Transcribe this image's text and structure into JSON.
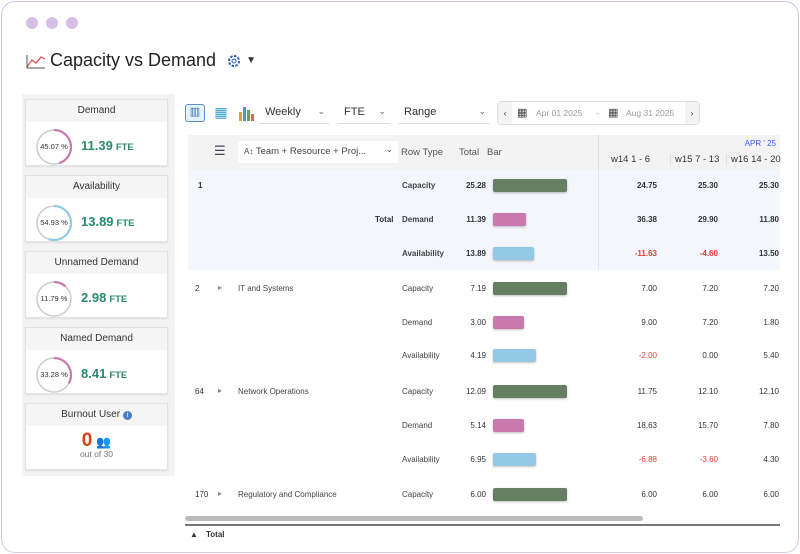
{
  "title": "Capacity vs Demand",
  "colors": {
    "capacity": "#667f63",
    "demand": "#c87aae",
    "availability": "#94c9e3",
    "fte": "#2b8a6e",
    "negative": "#e53935",
    "month": "#3d5afe"
  },
  "cards": [
    {
      "label": "Demand",
      "pct_text": "45.07 %",
      "pct": 45.07,
      "value": "11.39",
      "unit": "FTE",
      "color": "#c87aae"
    },
    {
      "label": "Availability",
      "pct_text": "54.93 %",
      "pct": 54.93,
      "value": "13.89",
      "unit": "FTE",
      "color": "#94c9e3"
    },
    {
      "label": "Unnamed Demand",
      "pct_text": "11.79 %",
      "pct": 11.79,
      "value": "2.98",
      "unit": "FTE",
      "color": "#c87aae"
    },
    {
      "label": "Named Demand",
      "pct_text": "33.28 %",
      "pct": 33.28,
      "value": "8.41",
      "unit": "FTE",
      "color": "#c87aae"
    }
  ],
  "burnout": {
    "label": "Burnout User",
    "count": "0",
    "sub": "out of 30"
  },
  "toolbar": {
    "period": "Weekly",
    "unit": "FTE",
    "range": "Range",
    "start": "Apr 01 2025",
    "sep": "-",
    "end": "Aug 31 2025"
  },
  "table": {
    "group_by": "Team + Resource + Proj...",
    "headers": {
      "row_type": "Row Type",
      "total": "Total",
      "bar": "Bar"
    },
    "month": "APR ' 25",
    "weeks": [
      "w14 1 - 6",
      "w15 7 - 13",
      "w16 14 - 20"
    ],
    "groups": [
      {
        "index": "1",
        "name": "Total",
        "bold": true,
        "rows": [
          {
            "type": "Capacity",
            "total": "25.28",
            "t": 25.28,
            "weeks": [
              "24.75",
              "25.30",
              "25.30"
            ]
          },
          {
            "type": "Demand",
            "total": "11.39",
            "t": 11.39,
            "weeks": [
              "36.38",
              "29.90",
              "11.80"
            ]
          },
          {
            "type": "Availability",
            "total": "13.89",
            "t": 13.89,
            "weeks": [
              "-11.63",
              "-4.60",
              "13.50"
            ]
          }
        ]
      },
      {
        "index": "2",
        "name": "IT and Systems",
        "rows": [
          {
            "type": "Capacity",
            "total": "7.19",
            "t": 7.19,
            "weeks": [
              "7.00",
              "7.20",
              "7.20"
            ]
          },
          {
            "type": "Demand",
            "total": "3.00",
            "t": 3.0,
            "weeks": [
              "9.00",
              "7.20",
              "1.80"
            ]
          },
          {
            "type": "Availability",
            "total": "4.19",
            "t": 4.19,
            "weeks": [
              "-2.00",
              "0.00",
              "5.40"
            ]
          }
        ]
      },
      {
        "index": "64",
        "name": "Network Operations",
        "rows": [
          {
            "type": "Capacity",
            "total": "12.09",
            "t": 12.09,
            "weeks": [
              "11.75",
              "12.10",
              "12.10"
            ]
          },
          {
            "type": "Demand",
            "total": "5.14",
            "t": 5.14,
            "weeks": [
              "18.63",
              "15.70",
              "7.80"
            ]
          },
          {
            "type": "Availability",
            "total": "6.95",
            "t": 6.95,
            "weeks": [
              "-6.88",
              "-3.60",
              "4.30"
            ]
          }
        ]
      },
      {
        "index": "170",
        "name": "Regulatory and Compliance",
        "rows": [
          {
            "type": "Capacity",
            "total": "6.00",
            "t": 6.0,
            "weeks": [
              "6.00",
              "6.00",
              "6.00"
            ]
          }
        ]
      }
    ],
    "footer": "Total"
  }
}
